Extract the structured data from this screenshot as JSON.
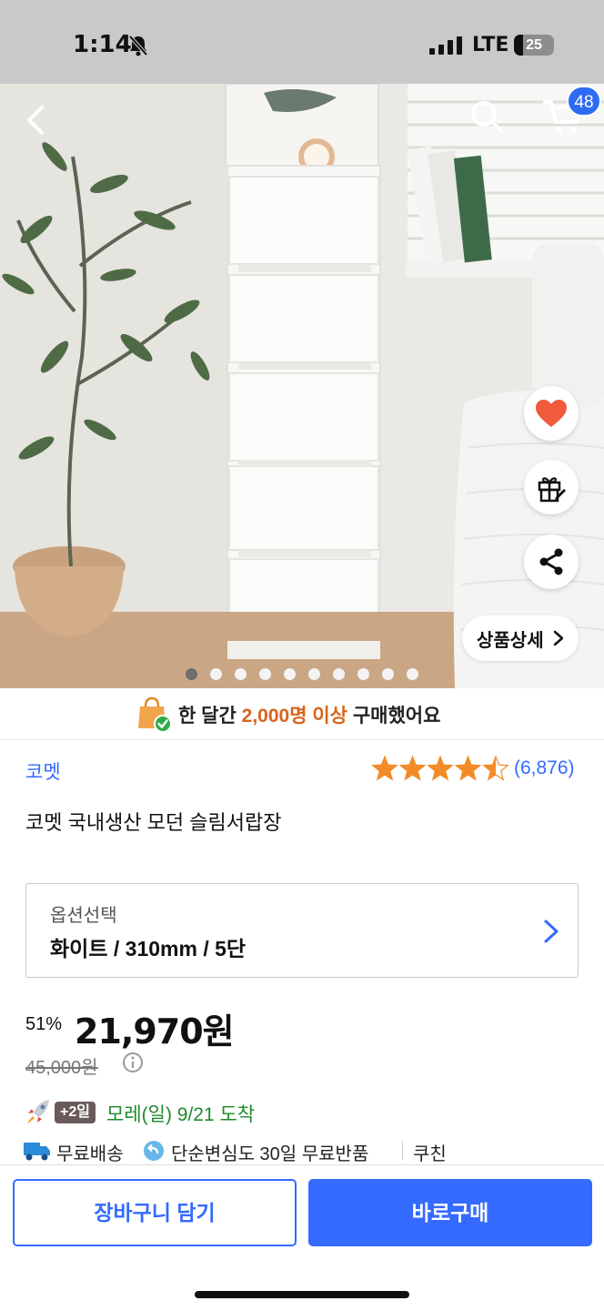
{
  "status_bar": {
    "time": "1:14",
    "network": "LTE",
    "battery": "25"
  },
  "header": {
    "cart_count": "48"
  },
  "hero": {
    "image_count": 10,
    "active_index": 0,
    "detail_button_label": "상품상세"
  },
  "banner": {
    "prefix": "한 달간 ",
    "highlight": "2,000명 이상",
    "suffix": " 구매했어요"
  },
  "product": {
    "brand": "코멧",
    "rating": 4.5,
    "review_count": "(6,876)",
    "title": "코멧 국내생산 모던 슬림서랍장"
  },
  "option": {
    "label": "옵션선택",
    "value": "화이트 / 310mm / 5단"
  },
  "pricing": {
    "discount": "51%",
    "price": "21,970원",
    "original_price": "45,000원"
  },
  "delivery": {
    "badge": "+2일",
    "arrival": "모레(일) 9/21 도착",
    "free_shipping": "무료배송",
    "free_return": "단순변심도 30일 무료반품",
    "coupon": "쿠친"
  },
  "actions": {
    "add_to_cart": "장바구니 담기",
    "buy_now": "바로구매"
  },
  "colors": {
    "accent": "#346aff",
    "highlight": "#d9631b",
    "arrival": "#1f8a2c",
    "heart": "#f05b3c"
  }
}
